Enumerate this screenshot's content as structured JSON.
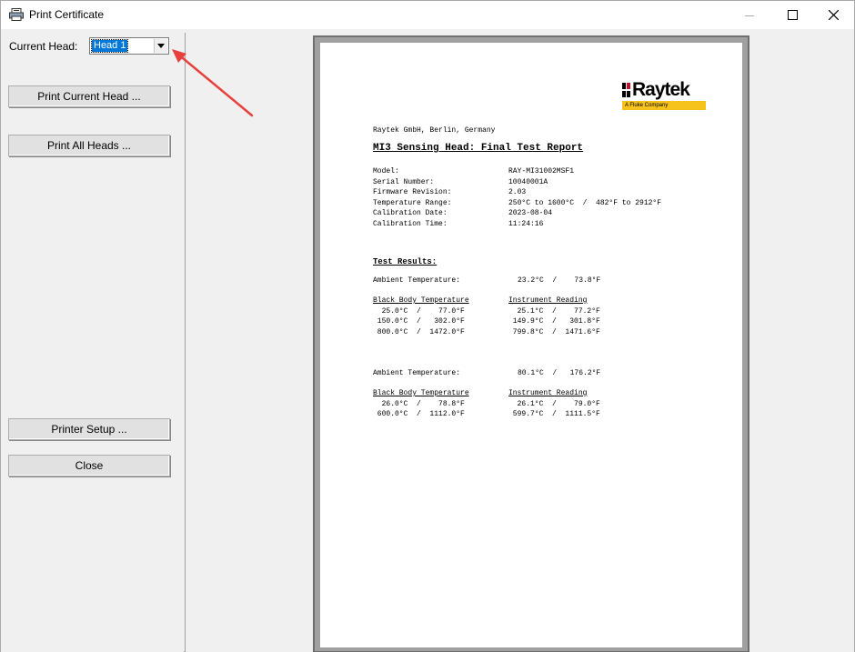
{
  "window": {
    "title": "Print Certificate"
  },
  "left": {
    "current_head_label": "Current Head:",
    "current_head_value": "Head 1",
    "print_current_label": "Print Current Head ...",
    "print_all_label": "Print All Heads ...",
    "printer_setup_label": "Printer Setup ...",
    "close_label": "Close"
  },
  "report": {
    "logo_text": "Raytek",
    "logo_sub": "A Fluke Company",
    "company": "Raytek GmbH, Berlin, Germany",
    "title": "MI3 Sensing Head: Final Test Report",
    "fields": [
      {
        "label": "Model:",
        "value": "RAY-MI31002MSF1"
      },
      {
        "label": "Serial Number:",
        "value": "10040001A"
      },
      {
        "label": "Firmware Revision:",
        "value": "2.03"
      },
      {
        "label": "Temperature Range:",
        "value": "250°C to 1600°C  /  482°F to 2912°F"
      },
      {
        "label": "Calibration Date:",
        "value": "2023-08-04"
      },
      {
        "label": "Calibration Time:",
        "value": "11:24:16"
      }
    ],
    "results_heading": "Test Results:",
    "ambient_label": "Ambient Temperature:",
    "bb_header": "Black Body Temperature",
    "ir_header": "Instrument Reading",
    "groups": [
      {
        "ambient": "23.2°C  /    73.8°F",
        "rows": [
          {
            "bb": "  25.0°C  /    77.0°F",
            "ir": "  25.1°C  /    77.2°F"
          },
          {
            "bb": " 150.0°C  /   302.0°F",
            "ir": " 149.9°C  /   301.8°F"
          },
          {
            "bb": " 800.0°C  /  1472.0°F",
            "ir": " 799.8°C  /  1471.6°F"
          }
        ]
      },
      {
        "ambient": "80.1°C  /   176.2°F",
        "rows": [
          {
            "bb": "  26.0°C  /    78.8°F",
            "ir": "  26.1°C  /    79.0°F"
          },
          {
            "bb": " 600.0°C  /  1112.0°F",
            "ir": " 599.7°C  /  1111.5°F"
          }
        ]
      }
    ]
  },
  "colors": {
    "accent": "#0078d7",
    "logo_yellow": "#f6c21c",
    "arrow_red": "#e8413c"
  }
}
